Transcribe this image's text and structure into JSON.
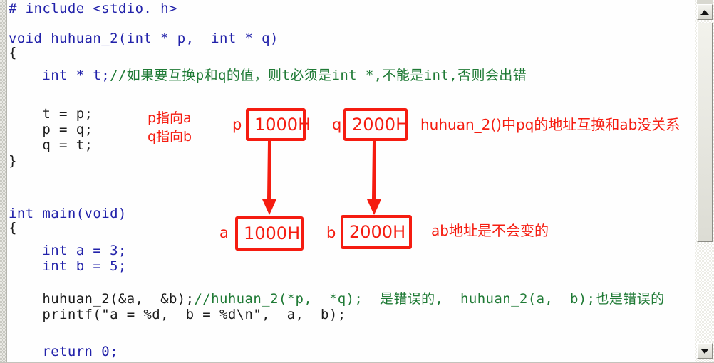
{
  "editor": {
    "language": "c",
    "colors": {
      "keyword": "#2222aa",
      "comment": "#1f7a35",
      "plain": "#1c1c1c",
      "annotation_red": "#f51c10",
      "background": "#fefefe",
      "gutter": "#e9e9e4"
    },
    "code_lines": [
      {
        "id": "l1",
        "text": "# include <stdio. h>"
      },
      {
        "id": "l2",
        "text": ""
      },
      {
        "id": "l3",
        "text": "void huhuan_2(int * p,  int * q)"
      },
      {
        "id": "l4",
        "text": "{"
      },
      {
        "id": "l5",
        "code": "    int * t;",
        "comment": "//如果要互换p和q的值，则t必须是int *,不能是int,否则会出错"
      },
      {
        "id": "l6",
        "text": ""
      },
      {
        "id": "l7",
        "text": "    t = p;"
      },
      {
        "id": "l8",
        "text": "    p = q;"
      },
      {
        "id": "l9",
        "text": "    q = t;"
      },
      {
        "id": "l10",
        "text": "}"
      },
      {
        "id": "l11",
        "text": ""
      },
      {
        "id": "l12",
        "text": ""
      },
      {
        "id": "l13",
        "text": "int main(void)"
      },
      {
        "id": "l14",
        "text": "{"
      },
      {
        "id": "l15",
        "text": "    int a = 3;"
      },
      {
        "id": "l16",
        "text": "    int b = 5;"
      },
      {
        "id": "l17",
        "text": ""
      },
      {
        "id": "l18",
        "code": "    huhuan_2(&a,  &b);",
        "comment": "//huhuan_2(*p,  *q);  是错误的,  huhuan_2(a,  b);也是错误的"
      },
      {
        "id": "l19",
        "text": "    printf(\"a = %d,  b = %d\\n\",  a,  b);"
      },
      {
        "id": "l20",
        "text": ""
      },
      {
        "id": "l21",
        "text": "    return 0;"
      }
    ]
  },
  "annotations": {
    "note_p_points_a": "p指向a",
    "note_q_points_b": "q指向b",
    "note_huhuan": "huhuan_2()中pq的地址互换和ab没关系",
    "note_ab_fixed": "ab地址是不会变的",
    "boxes": [
      {
        "id": "box-p",
        "label": "p",
        "value": "1000H"
      },
      {
        "id": "box-q",
        "label": "q",
        "value": "2000H"
      },
      {
        "id": "box-a",
        "label": "a",
        "value": "1000H"
      },
      {
        "id": "box-b",
        "label": "b",
        "value": "2000H"
      }
    ]
  },
  "scrollbar": {
    "up_arrow": "scroll-up",
    "down_arrow": "scroll-down",
    "thumb": "scroll-thumb"
  }
}
